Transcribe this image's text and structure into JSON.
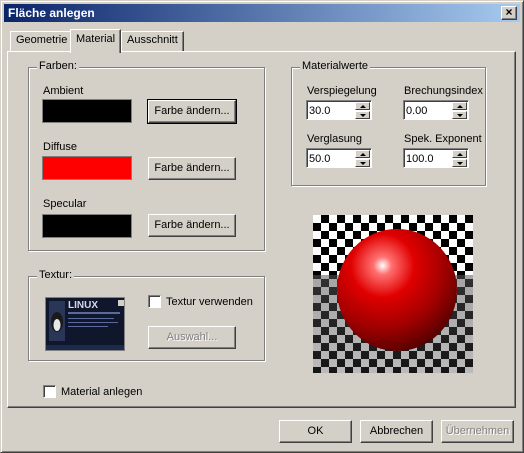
{
  "window": {
    "title": "Fläche anlegen",
    "close": "×"
  },
  "tabs": [
    {
      "label": "Geometrie",
      "active": false
    },
    {
      "label": "Material",
      "active": true
    },
    {
      "label": "Ausschnitt",
      "active": false
    }
  ],
  "farben": {
    "title": "Farben:",
    "ambient": {
      "label": "Ambient",
      "color": "#000000",
      "button": "Farbe ändern..."
    },
    "diffuse": {
      "label": "Diffuse",
      "color": "#ff0000",
      "button": "Farbe ändern..."
    },
    "specular": {
      "label": "Specular",
      "color": "#000000",
      "button": "Farbe ändern..."
    }
  },
  "materialwerte": {
    "title": "Materialwerte",
    "verspiegelung": {
      "label": "Verspiegelung",
      "value": "30.0"
    },
    "brechungsindex": {
      "label": "Brechungsindex",
      "value": "0.00"
    },
    "verglasung": {
      "label": "Verglasung",
      "value": "50.0"
    },
    "spek_exponent": {
      "label": "Spek. Exponent",
      "value": "100.0"
    }
  },
  "textur": {
    "title": "Textur:",
    "use_label": "Textur verwenden",
    "use_checked": false,
    "select_button": "Auswahl...",
    "thumbnail_text": "LINUX"
  },
  "material_anlegen": {
    "label": "Material anlegen",
    "checked": false
  },
  "buttons": {
    "ok": "OK",
    "cancel": "Abbrechen",
    "apply": "Übernehmen"
  },
  "preview": {
    "sphere_color": "#e00000",
    "floor": "checkerboard"
  }
}
